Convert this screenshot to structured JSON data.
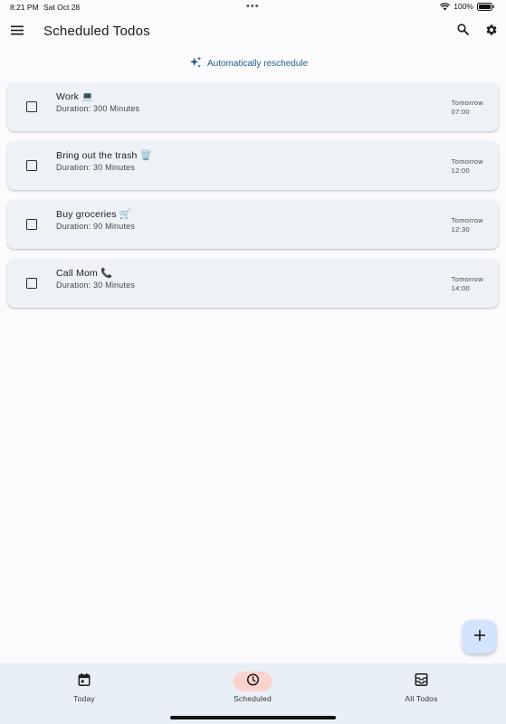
{
  "status_bar": {
    "time": "8:21 PM",
    "date": "Sat Oct 28",
    "battery": "100%"
  },
  "app_bar": {
    "title": "Scheduled Todos",
    "menu_icon": "menu-icon",
    "search_icon": "search-icon",
    "settings_icon": "gear-icon"
  },
  "reschedule": {
    "label": "Automatically reschedule",
    "icon": "sparkle-icon",
    "color": "#1e5c8a"
  },
  "todos": [
    {
      "title": "Work 💻",
      "duration": "Duration: 300 Minutes",
      "day": "Tomorrow",
      "time": "07:00",
      "checked": false
    },
    {
      "title": "Bring out the trash 🗑️",
      "duration": "Duration: 30 Minutes",
      "day": "Tomorrow",
      "time": "12:00",
      "checked": false
    },
    {
      "title": "Buy groceries 🛒",
      "duration": "Duration: 90 Minutes",
      "day": "Tomorrow",
      "time": "12:30",
      "checked": false
    },
    {
      "title": "Call Mom 📞",
      "duration": "Duration: 30 Minutes",
      "day": "Tomorrow",
      "time": "14:00",
      "checked": false
    }
  ],
  "fab": {
    "icon": "plus-icon",
    "color": "#d3e4ff"
  },
  "bottom_nav": {
    "items": [
      {
        "label": "Today",
        "icon": "calendar-icon",
        "active": false
      },
      {
        "label": "Scheduled",
        "icon": "clock-icon",
        "active": true
      },
      {
        "label": "All Todos",
        "icon": "inbox-icon",
        "active": false
      }
    ],
    "active_color": "#fbd3cd"
  }
}
